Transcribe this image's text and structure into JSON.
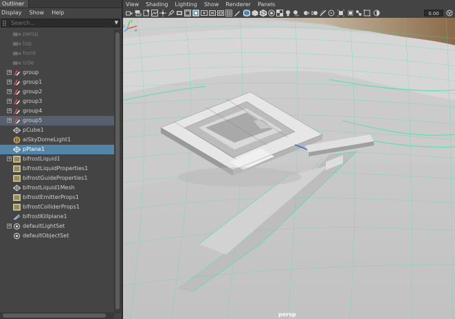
{
  "outliner": {
    "tab_label": "Outliner",
    "menu": [
      "Display",
      "Show",
      "Help"
    ],
    "search_placeholder": "Search...",
    "items": [
      {
        "label": "persp",
        "icon": "camera-icon",
        "dim": true
      },
      {
        "label": "top",
        "icon": "camera-icon",
        "dim": true
      },
      {
        "label": "front",
        "icon": "camera-icon",
        "dim": true
      },
      {
        "label": "side",
        "icon": "camera-icon",
        "dim": true
      },
      {
        "label": "group",
        "icon": "group-icon",
        "expandable": true
      },
      {
        "label": "group1",
        "icon": "group-icon",
        "expandable": true
      },
      {
        "label": "group2",
        "icon": "group-icon",
        "expandable": true
      },
      {
        "label": "group3",
        "icon": "group-icon",
        "expandable": true
      },
      {
        "label": "group4",
        "icon": "group-icon",
        "expandable": true
      },
      {
        "label": "group5",
        "icon": "group-icon",
        "expandable": true,
        "highlight": true
      },
      {
        "label": "pCube1",
        "icon": "mesh-icon"
      },
      {
        "label": "aiSkyDomeLight1",
        "icon": "skydome-icon"
      },
      {
        "label": "pPlane1",
        "icon": "mesh-icon",
        "selected": true
      },
      {
        "label": "bifrostLiquid1",
        "icon": "bifrost-icon",
        "expandable": true
      },
      {
        "label": "bifrostLiquidProperties1",
        "icon": "bifrost-props-icon"
      },
      {
        "label": "bifrostGuideProperties1",
        "icon": "bifrost-props-icon"
      },
      {
        "label": "bifrostLiquid1Mesh",
        "icon": "mesh-icon"
      },
      {
        "label": "bifrostEmitterProps1",
        "icon": "bifrost-props-icon"
      },
      {
        "label": "bifrostColliderProps1",
        "icon": "bifrost-props-icon"
      },
      {
        "label": "bifrostKillplane1",
        "icon": "killplane-icon"
      },
      {
        "label": "defaultLightSet",
        "icon": "set-icon",
        "expandable": true
      },
      {
        "label": "defaultObjectSet",
        "icon": "set-icon"
      }
    ]
  },
  "viewport": {
    "menu": [
      "View",
      "Shading",
      "Lighting",
      "Show",
      "Renderer",
      "Panels"
    ],
    "field_value": "0.00",
    "camera_label": "persp"
  },
  "colors": {
    "selection": "#5285a6",
    "wire_highlight": "#3ce6a0"
  }
}
